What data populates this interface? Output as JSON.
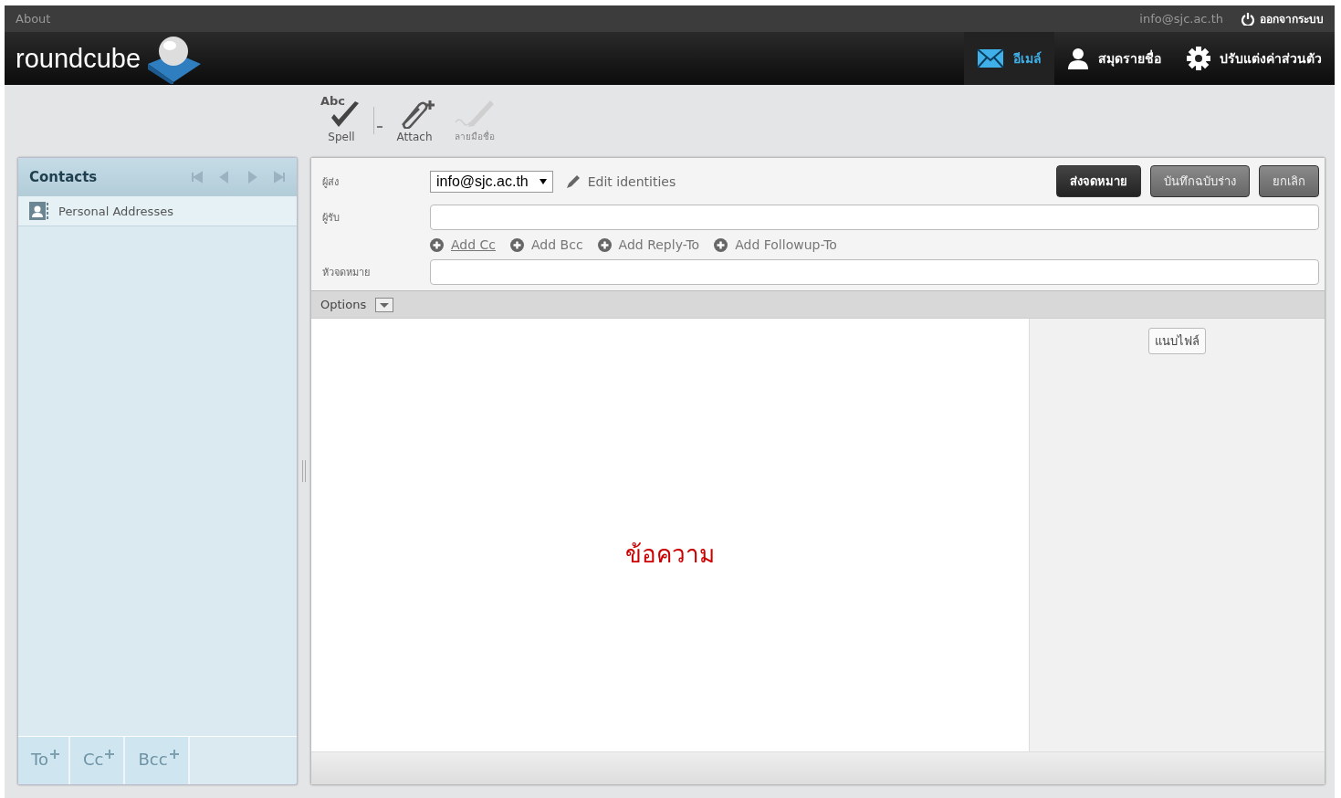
{
  "topbar": {
    "about": "About",
    "user": "info@sjc.ac.th",
    "logout": "ออกจากระบบ"
  },
  "logo": {
    "text": "roundcube"
  },
  "nav": [
    {
      "label": "อีเมล์",
      "selected": true
    },
    {
      "label": "สมุดรายชื่อ",
      "selected": false
    },
    {
      "label": "ปรับแต่งค่าส่วนตัว",
      "selected": false
    }
  ],
  "toolbar": [
    {
      "label": "Spell",
      "icon_text": "Abc",
      "disabled": false,
      "menu": true
    },
    {
      "label": "Attach",
      "disabled": false,
      "menu": false
    },
    {
      "label": "ลายมือชื่อ",
      "disabled": true,
      "menu": false
    }
  ],
  "contacts": {
    "title": "Contacts",
    "items": [
      {
        "label": "Personal Addresses",
        "selected": false
      }
    ],
    "recipients": [
      "To",
      "Cc",
      "Bcc"
    ]
  },
  "compose": {
    "sender_label": "ผู้ส่ง",
    "sender_value": "info@sjc.ac.th",
    "edit_identities": "Edit identities",
    "recipient_label": "ผู้รับ",
    "add_links": [
      {
        "label": "Add Cc",
        "hovered": true
      },
      {
        "label": "Add Bcc",
        "hovered": false
      },
      {
        "label": "Add Reply-To",
        "hovered": false
      },
      {
        "label": "Add Followup-To",
        "hovered": false
      }
    ],
    "subject_label": "หัวจดหมาย",
    "actions": [
      {
        "label": "ส่งจดหมาย",
        "kind": "primary"
      },
      {
        "label": "บันทึกฉบับร่าง",
        "kind": "secondary"
      },
      {
        "label": "ยกเลิก",
        "kind": "secondary"
      }
    ],
    "options": "Options",
    "body": "ข้อความ",
    "attach_button": "แนบไฟล์"
  }
}
